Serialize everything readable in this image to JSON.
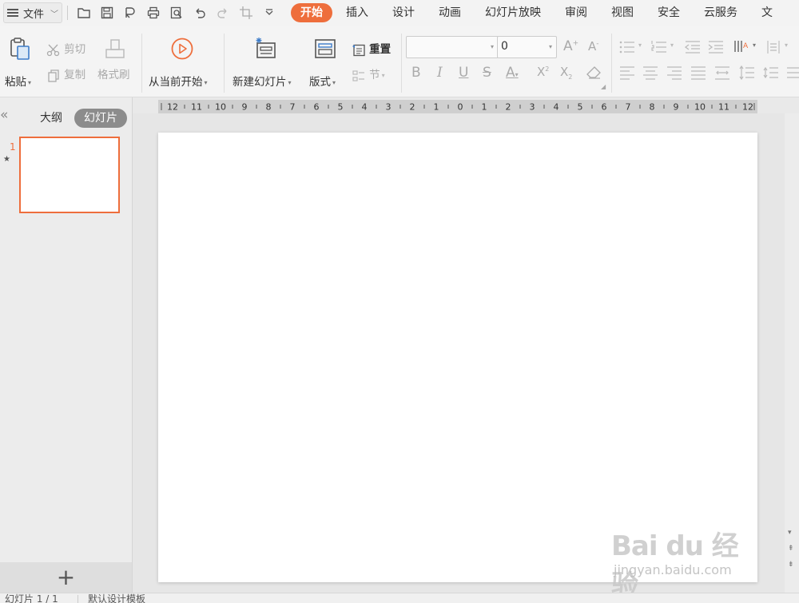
{
  "menubar": {
    "file_label": "文件",
    "tabs": [
      "开始",
      "插入",
      "设计",
      "动画",
      "幻灯片放映",
      "审阅",
      "视图",
      "安全",
      "云服务",
      "文"
    ],
    "active_tab": "开始"
  },
  "ribbon": {
    "paste": "粘贴",
    "cut": "剪切",
    "copy": "复制",
    "format_painter": "格式刷",
    "from_current": "从当前开始",
    "new_slide": "新建幻灯片",
    "layout": "版式",
    "reset": "重置",
    "section": "节",
    "font_name": "",
    "font_size": "0"
  },
  "ruler": {
    "labels": "12 · 11 · 10 · 9 · 8 · 7 · 6 · 5 · 4 · 3 · 2 · 1 · 0 · 1 · 2 · 3 · 4 · 5 · 6 · 7 · 8 · 9 · 10 · 11 · 12"
  },
  "left_panel": {
    "outline_tab": "大纲",
    "slides_tab": "幻灯片",
    "slide_number": "1",
    "add_slide_symbol": "+"
  },
  "watermark": {
    "brand": "Bai du 经验",
    "site": "jingyan.baidu.com"
  },
  "statusbar": {
    "left": "幻灯片 1 / 1",
    "right": "默认设计模板"
  },
  "colors": {
    "accent": "#ee6e3c",
    "slides_tab_bg": "#8c8c8c"
  }
}
